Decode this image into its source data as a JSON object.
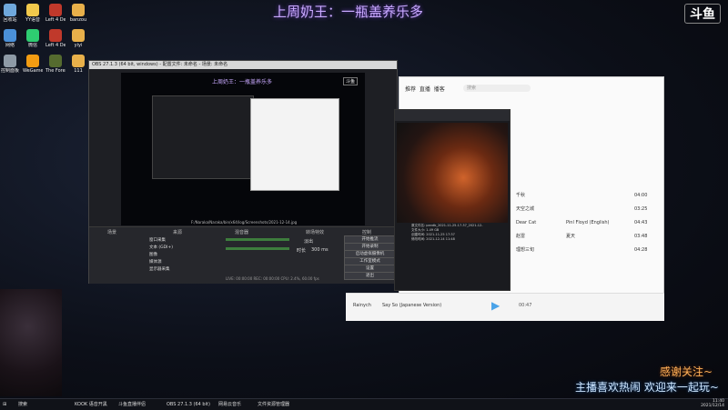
{
  "overlay": {
    "stream_title": "上周奶王：一瓶盖养乐多",
    "brand_logo": "斗鱼",
    "thanks_text": "感谢关注~",
    "welcome_text": "主播喜欢热闹 欢迎来一起玩~"
  },
  "desktop_icons": [
    {
      "label": "回收站",
      "icon": "recycle-bin-icon",
      "color": "#6fa8dc"
    },
    {
      "label": "YY语音",
      "icon": "yy-icon",
      "color": "#f2c94c"
    },
    {
      "label": "Left 4 Dead",
      "icon": "left4dead-icon",
      "color": "#c0392b"
    },
    {
      "label": "banzou",
      "icon": "folder-icon",
      "color": "#e8b04a"
    },
    {
      "label": "网络",
      "icon": "network-icon",
      "color": "#4a90d9"
    },
    {
      "label": "微信",
      "icon": "wechat-icon",
      "color": "#2ecc71"
    },
    {
      "label": "Left 4 Dead 2",
      "icon": "left4dead2-icon",
      "color": "#c0392b"
    },
    {
      "label": "yiyi",
      "icon": "folder-icon",
      "color": "#e8b04a"
    },
    {
      "label": "控制面板",
      "icon": "control-panel-icon",
      "color": "#8e9aa6"
    },
    {
      "label": "WeGame",
      "icon": "wegame-icon",
      "color": "#f39c12"
    },
    {
      "label": "The Forest",
      "icon": "theforest-icon",
      "color": "#556b2f"
    },
    {
      "label": "111",
      "icon": "folder-icon",
      "color": "#e8b04a"
    }
  ],
  "obs": {
    "window_title": "OBS 27.1.3 (64 bit, windows) - 配置文件: 未命名 - 场景: 未命名",
    "preview_title": "上周奶王：一瓶盖养乐多",
    "preview_logo": "斗鱼",
    "scenes_header": "场景",
    "sources_header": "来源",
    "mixer_header": "混音器",
    "transitions_header": "转场特效",
    "controls_header": "控制",
    "path_label": "F:/Naraka/Naraka/bin/x64/log/Screenshots/2021-12-14.jpg",
    "sources": [
      "窗口采集",
      "文本 (GDI+)",
      "图像",
      "媒体源",
      "显示器采集"
    ],
    "transition_value": "淡出",
    "duration_label": "时长",
    "duration_value": "300 ms",
    "controls": [
      "开始推流",
      "开始录制",
      "启动虚拟摄像机",
      "工作室模式",
      "设置",
      "退出"
    ],
    "status": "LIVE: 00:00:00  REC: 00:00:00  CPU: 2.4%, 60.00 fps"
  },
  "music": {
    "nav": [
      "推荐",
      "直播",
      "播客"
    ],
    "search_placeholder": "搜索",
    "songs": [
      {
        "title": "千秋",
        "artist": "",
        "time": "04:00"
      },
      {
        "title": "天空之城",
        "artist": "",
        "time": "03:25"
      },
      {
        "title": "Dear Cat",
        "artist": "Pinl Floyd (English)",
        "time": "04:43"
      },
      {
        "title": "赵雷",
        "artist": "夏天",
        "time": "03:48"
      },
      {
        "title": "理想三旬",
        "artist": "",
        "time": "04:28"
      }
    ],
    "now_playing": "Say So (Japanese Version)",
    "now_artist": "Rainych",
    "player_time": "00:47"
  },
  "popup": {
    "info_lines": [
      "原文件名: pandb_2021-11-25-17-37_2021-12-",
      "文件大小: 1.49 GB",
      "创建时间: 2021-11-25 17:37",
      "修改时间: 2021-12-14 11:48"
    ]
  },
  "taskbar": {
    "items": [
      "搜索",
      "KOOK 语音开黑",
      "斗鱼直播伴侣",
      "OBS 27.1.3 (64 bit)",
      "网易云音乐",
      "文件资源管理器"
    ],
    "time": "11:40",
    "date": "2021/12/14"
  }
}
